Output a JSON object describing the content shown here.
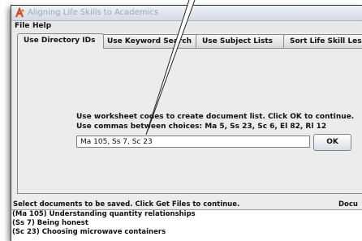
{
  "window": {
    "title": "Aligning Life Skills to Academics"
  },
  "menu": [
    {
      "label": "File"
    },
    {
      "label": "Help"
    }
  ],
  "tabs": [
    {
      "label": "Use Directory IDs",
      "active": true
    },
    {
      "label": "Use Keyword Search",
      "active": false
    },
    {
      "label": "Use Subject Lists",
      "active": false
    },
    {
      "label": "Sort Life Skill Lessons",
      "active": false
    }
  ],
  "instructions": {
    "line1": "Use worksheet codes to create document list. Click OK to continue.",
    "line2": "Use commas between choices: Ma 5, Ss 23, Sc 6, El 82, Rl 12"
  },
  "codes_input": {
    "value": "Ma 105, Ss 7, Sc 23"
  },
  "ok_button": {
    "label": "OK"
  },
  "status": {
    "message": "Select documents to be saved. Click Get Files to continue.",
    "right_label": "Docu"
  },
  "documents": [
    {
      "code": "(Ma 105)",
      "title": "Understanding quantity relationships"
    },
    {
      "code": "(Ss 7)",
      "title": "Being honest"
    },
    {
      "code": "(Sc 23)",
      "title": "Choosing microwave containers"
    }
  ],
  "colors": {
    "title_text": "#9aa6bc",
    "panel": "#ececec",
    "app_icon": "#d34a1c"
  }
}
